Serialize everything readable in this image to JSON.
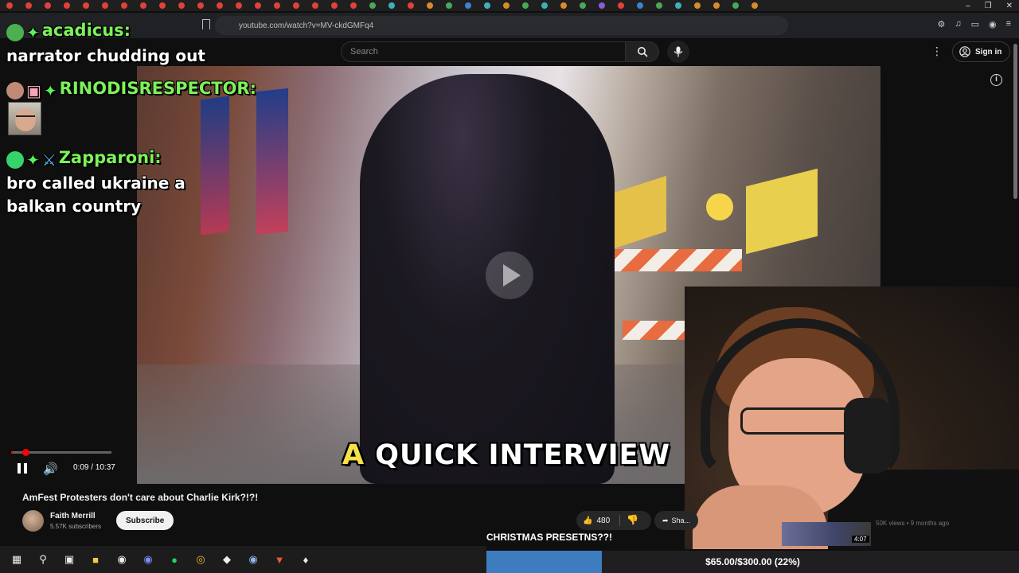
{
  "browser": {
    "url": "youtube.com/watch?v=MV-ckdGMFq4",
    "tab_dot_colors": [
      "#e0413a",
      "#e0413a",
      "#e0413a",
      "#e0413a",
      "#e0413a",
      "#e0413a",
      "#e0413a",
      "#e0413a",
      "#e0413a",
      "#e0413a",
      "#e0413a",
      "#e0413a",
      "#e0413a",
      "#e0413a",
      "#e0413a",
      "#e0413a",
      "#e0413a",
      "#e0413a",
      "#e0413a",
      "#49a85a",
      "#3fb0b8",
      "#e0413a",
      "#d88a2e",
      "#49a85a",
      "#3b82d0",
      "#3fb0b8",
      "#d88a2e",
      "#49a85a",
      "#3fb0b8",
      "#d88a2e",
      "#49a85a",
      "#8a5cd6",
      "#e0413a",
      "#3b82d0",
      "#49a85a",
      "#3fb0b8",
      "#d88a2e",
      "#d88a2e",
      "#49a85a",
      "#d88a2e"
    ]
  },
  "youtube": {
    "search_placeholder": "Search",
    "sign_in_label": "Sign in",
    "video_title": "AmFest Protesters don't care about Charlie Kirk?!?!",
    "channel_name": "Faith Merrill",
    "subscriber_count": "5.57K subscribers",
    "subscribe_label": "Subscribe",
    "like_count": "480",
    "share_label": "Sha...",
    "player": {
      "time": "0:09 / 10:37",
      "progress_fraction": 0.014
    },
    "caption": {
      "word1": "A",
      "word2": "QUICK INTERVIEW"
    },
    "recommended": {
      "duration": "4:07",
      "meta": "50K views • 9 months ago"
    }
  },
  "chat": [
    {
      "name": "acadicus:",
      "message": "narrator chudding out",
      "badge_color": "#4caf50"
    },
    {
      "name": "RINODISRESPECTOR:",
      "message": "",
      "badge_color": "#c08a76"
    },
    {
      "name": "Zapparoni:",
      "message": "bro called ukraine a balkan country",
      "badge_color": "#36d36a"
    }
  ],
  "overlay": {
    "goal_title": "CHRISTMAS PRESETNS??!",
    "goal_text": "$65.00/$300.00 (22%)",
    "goal_fraction": 0.2167
  },
  "taskbar": {
    "icons": [
      "windows-start-icon",
      "search-icon",
      "task-view-icon",
      "file-explorer-icon",
      "obs-icon",
      "discord-icon",
      "spotify-icon",
      "chrome-icon",
      "app-icon",
      "steam-icon",
      "brave-icon",
      "app2-icon"
    ]
  }
}
